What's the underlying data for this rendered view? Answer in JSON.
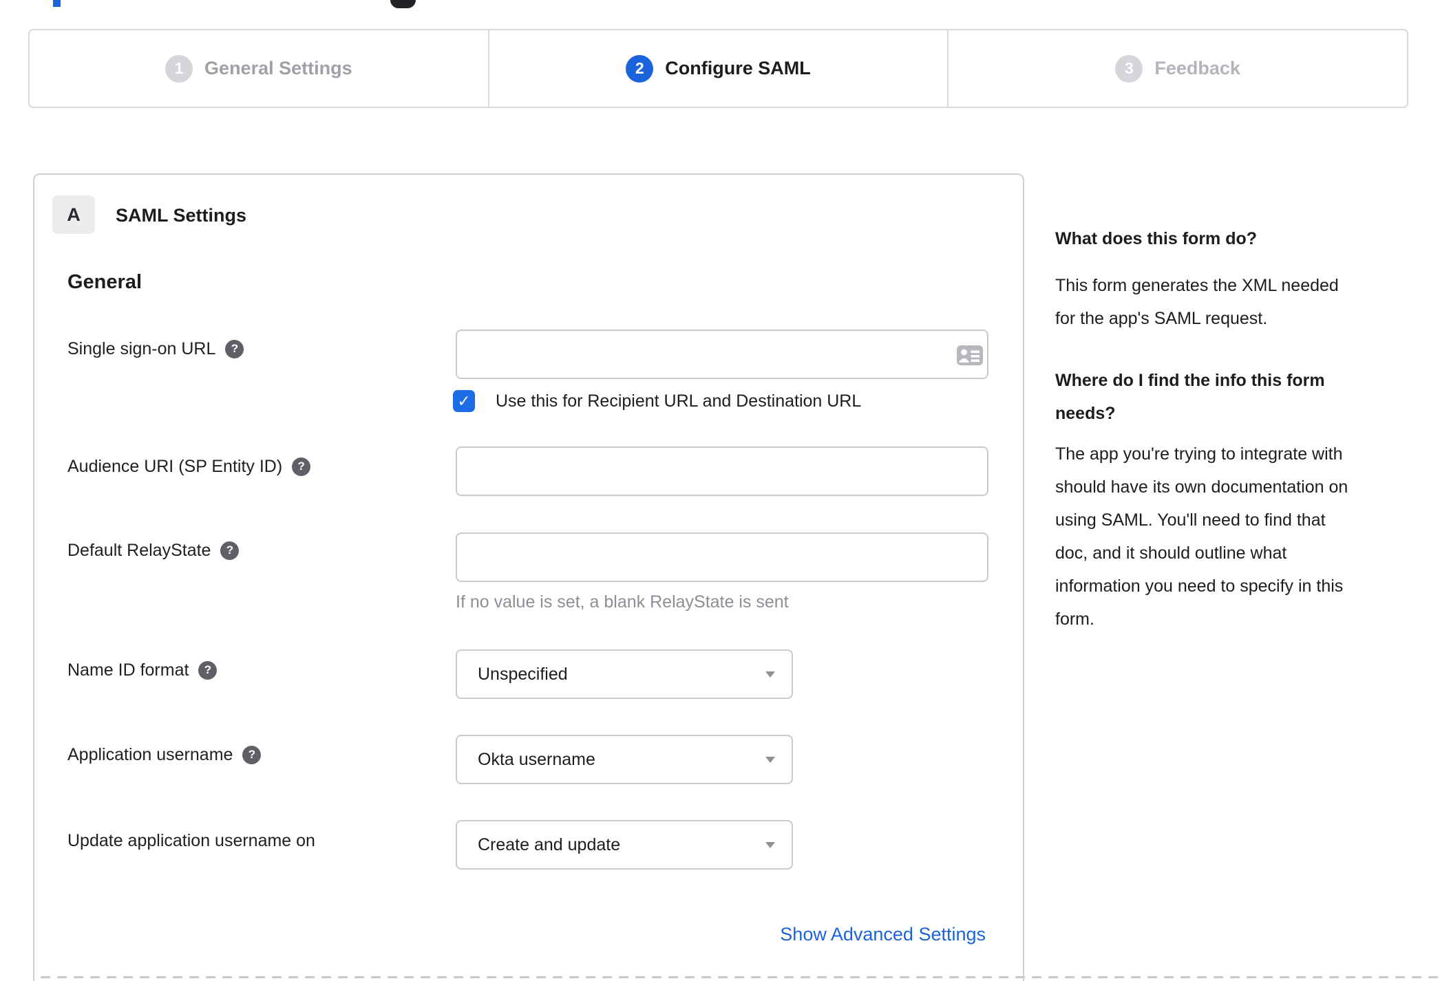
{
  "colors": {
    "accent_blue": "#1b63dd",
    "checkbox_blue": "#1c6ce8",
    "link_blue": "#1b63dd",
    "body_text": "#1d1d21",
    "inactive_step_text": "#a4a4ac",
    "hint_text": "#8e8e96",
    "border_gray": "#c9c9cf"
  },
  "stepper": {
    "steps": [
      {
        "number": "1",
        "label": "General Settings",
        "state": "inactive"
      },
      {
        "number": "2",
        "label": "Configure SAML",
        "state": "active"
      },
      {
        "number": "3",
        "label": "Feedback",
        "state": "inactive"
      }
    ]
  },
  "panel": {
    "badge": "A",
    "title": "SAML Settings",
    "section_heading": "General",
    "help_icon_glyph": "?",
    "fields": [
      {
        "label": "Single sign-on URL",
        "type": "text",
        "value": ""
      },
      {
        "label": "Audience URI (SP Entity ID)",
        "type": "text",
        "value": ""
      },
      {
        "label": "Default RelayState",
        "type": "text",
        "value": "",
        "hint": "If no value is set, a blank RelayState is sent"
      },
      {
        "label": "Name ID format",
        "type": "select",
        "value": "Unspecified"
      },
      {
        "label": "Application username",
        "type": "select",
        "value": "Okta username"
      },
      {
        "label": "Update application username on",
        "type": "select",
        "value": "Create and update"
      }
    ],
    "checkbox": {
      "checked": true,
      "glyph": "✓",
      "label": "Use this for Recipient URL and Destination URL"
    },
    "advanced_link": "Show Advanced Settings"
  },
  "sidebar": {
    "heading1": "What does this form do?",
    "paragraph1": "This form generates the XML needed\nfor the app's SAML request.",
    "heading2": "Where do I find the info this form\nneeds?",
    "paragraph2": "The app you're trying to integrate with\nshould have its own documentation on\nusing SAML. You'll need to find that\ndoc, and it should outline what\ninformation you need to specify in this\nform."
  }
}
